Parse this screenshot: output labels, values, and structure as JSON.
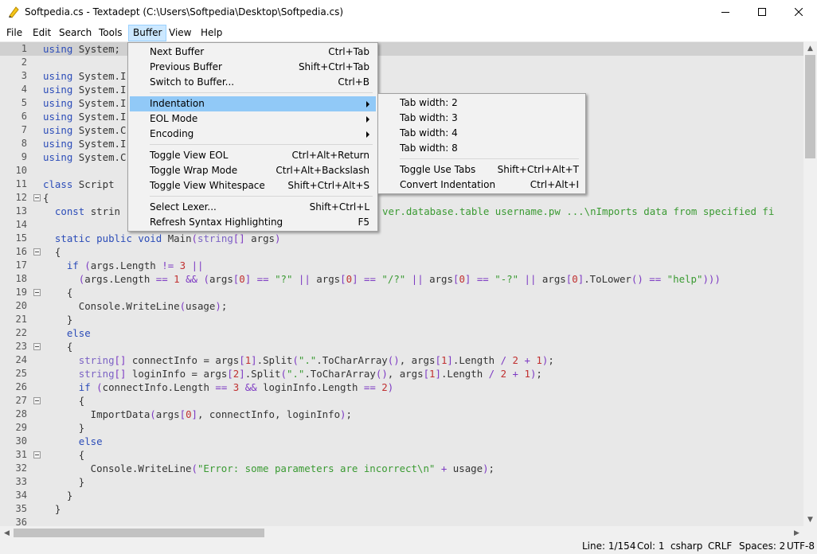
{
  "window": {
    "title": "Softpedia.cs - Textadept (C:\\Users\\Softpedia\\Desktop\\Softpedia.cs)"
  },
  "menubar": [
    {
      "label": "File"
    },
    {
      "label": "Edit"
    },
    {
      "label": "Search"
    },
    {
      "label": "Tools"
    },
    {
      "label": "Buffer"
    },
    {
      "label": "View"
    },
    {
      "label": "Help"
    }
  ],
  "buffer_menu": {
    "next_buffer": {
      "label": "Next Buffer",
      "shortcut": "Ctrl+Tab"
    },
    "previous_buffer": {
      "label": "Previous Buffer",
      "shortcut": "Shift+Ctrl+Tab"
    },
    "switch_to_buffer": {
      "label": "Switch to Buffer...",
      "shortcut": "Ctrl+B"
    },
    "indentation": {
      "label": "Indentation"
    },
    "eol_mode": {
      "label": "EOL Mode"
    },
    "encoding": {
      "label": "Encoding"
    },
    "toggle_view_eol": {
      "label": "Toggle View EOL",
      "shortcut": "Ctrl+Alt+Return"
    },
    "toggle_wrap_mode": {
      "label": "Toggle Wrap Mode",
      "shortcut": "Ctrl+Alt+Backslash"
    },
    "toggle_view_whitespace": {
      "label": "Toggle View Whitespace",
      "shortcut": "Shift+Ctrl+Alt+S"
    },
    "select_lexer": {
      "label": "Select Lexer...",
      "shortcut": "Shift+Ctrl+L"
    },
    "refresh_syntax": {
      "label": "Refresh Syntax Highlighting",
      "shortcut": "F5"
    }
  },
  "indentation_menu": {
    "tab_width_2": {
      "label": "Tab width: 2"
    },
    "tab_width_3": {
      "label": "Tab width: 3"
    },
    "tab_width_4": {
      "label": "Tab width: 4"
    },
    "tab_width_8": {
      "label": "Tab width: 8"
    },
    "toggle_use_tabs": {
      "label": "Toggle Use Tabs",
      "shortcut": "Shift+Ctrl+Alt+T"
    },
    "convert_indentation": {
      "label": "Convert Indentation",
      "shortcut": "Ctrl+Alt+I"
    }
  },
  "editor": {
    "lines": [
      {
        "n": "1",
        "text": "using System;"
      },
      {
        "n": "2",
        "text": ""
      },
      {
        "n": "3",
        "text": "using System.I"
      },
      {
        "n": "4",
        "text": "using System.I"
      },
      {
        "n": "5",
        "text": "using System.I"
      },
      {
        "n": "6",
        "text": "using System.I"
      },
      {
        "n": "7",
        "text": "using System.C"
      },
      {
        "n": "8",
        "text": "using System.I"
      },
      {
        "n": "9",
        "text": "using System.C"
      },
      {
        "n": "10",
        "text": ""
      },
      {
        "n": "11",
        "text": "class Script"
      },
      {
        "n": "12",
        "text": "{"
      },
      {
        "n": "13",
        "text": "  const strin",
        "tail": "ver.database.table username.pw ...\\nImports data from specified fi"
      },
      {
        "n": "14",
        "text": ""
      },
      {
        "n": "15",
        "text": "  static public void Main(string[] args)"
      },
      {
        "n": "16",
        "text": "  {"
      },
      {
        "n": "17",
        "text": "    if (args.Length != 3 ||"
      },
      {
        "n": "18",
        "text": "      (args.Length == 1 && (args[0] == \"?\" || args[0] == \"/?\" || args[0] == \"-?\" || args[0].ToLower() == \"help\")))"
      },
      {
        "n": "19",
        "text": "    {"
      },
      {
        "n": "20",
        "text": "      Console.WriteLine(usage);"
      },
      {
        "n": "21",
        "text": "    }"
      },
      {
        "n": "22",
        "text": "    else"
      },
      {
        "n": "23",
        "text": "    {"
      },
      {
        "n": "24",
        "text": "      string[] connectInfo = args[1].Split(\".\".ToCharArray(), args[1].Length / 2 + 1);"
      },
      {
        "n": "25",
        "text": "      string[] loginInfo = args[2].Split(\".\".ToCharArray(), args[1].Length / 2 + 1);"
      },
      {
        "n": "26",
        "text": "      if (connectInfo.Length == 3 && loginInfo.Length == 2)"
      },
      {
        "n": "27",
        "text": "      {"
      },
      {
        "n": "28",
        "text": "        ImportData(args[0], connectInfo, loginInfo);"
      },
      {
        "n": "29",
        "text": "      }"
      },
      {
        "n": "30",
        "text": "      else"
      },
      {
        "n": "31",
        "text": "      {"
      },
      {
        "n": "32",
        "text": "        Console.WriteLine(\"Error: some parameters are incorrect\\n\" + usage);"
      },
      {
        "n": "33",
        "text": "      }"
      },
      {
        "n": "34",
        "text": "    }"
      },
      {
        "n": "35",
        "text": "  }"
      },
      {
        "n": "36",
        "text": ""
      }
    ],
    "fold_lines": [
      "12",
      "16",
      "19",
      "23",
      "27",
      "31"
    ],
    "current_line": "1"
  },
  "statusbar": {
    "line": "Line: 1/154",
    "col": "Col: 1",
    "lexer": "csharp",
    "eol": "CRLF",
    "indent": "Spaces: 2",
    "encoding": "UTF-8"
  },
  "colors": {
    "keyword": "#2b4cb8",
    "type": "#7b62c4",
    "string": "#3a9a32",
    "number": "#c03030",
    "menu_highlight": "#91c9f7",
    "editor_bg": "#e8e8e8"
  },
  "icons": {
    "app": "textadept-pen-icon",
    "minimize": "minimize-icon",
    "maximize": "maximize-icon",
    "close": "close-icon"
  }
}
